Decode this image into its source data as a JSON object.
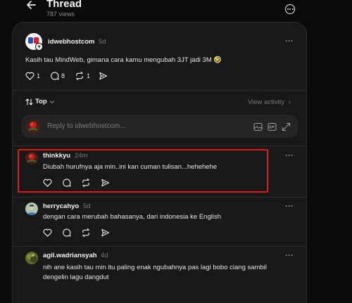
{
  "header": {
    "title": "Thread",
    "views": "787 views"
  },
  "post": {
    "username": "idwebhostcom",
    "time": "5d",
    "text": "Kasih tau MindWeb, gimana cara kamu mengubah 3JT jadi 3M 🤣",
    "likes": "1",
    "comments": "8",
    "reposts": "1"
  },
  "sort": {
    "label": "Top",
    "view_activity": "View activity"
  },
  "reply": {
    "placeholder": "Reply to idwebhostcom..."
  },
  "comments": [
    {
      "username": "thinkkyu",
      "time": "24m",
      "text": "Diubah hurufnya aja min..ini kan cuman tulisan...hehehehe"
    },
    {
      "username": "herrycahyo",
      "time": "5d",
      "text": "dengan cara merubah bahasanya, dari indonesia ke English"
    },
    {
      "username": "agil.wadriansyah",
      "time": "4d",
      "text_line1": "nih ane kasih tau min itu paling enak ngubahnya pas lagi bobo ciang sambil",
      "text_line2": "dengelin lagu dangdut"
    }
  ],
  "colors": {
    "background": "#0a0a0a",
    "panel": "#181818",
    "highlight": "#e01818"
  },
  "icons": [
    "back-arrow-icon",
    "more-circle-icon",
    "heart-icon",
    "comment-icon",
    "repost-icon",
    "share-icon",
    "gif-icon",
    "expand-icon"
  ]
}
